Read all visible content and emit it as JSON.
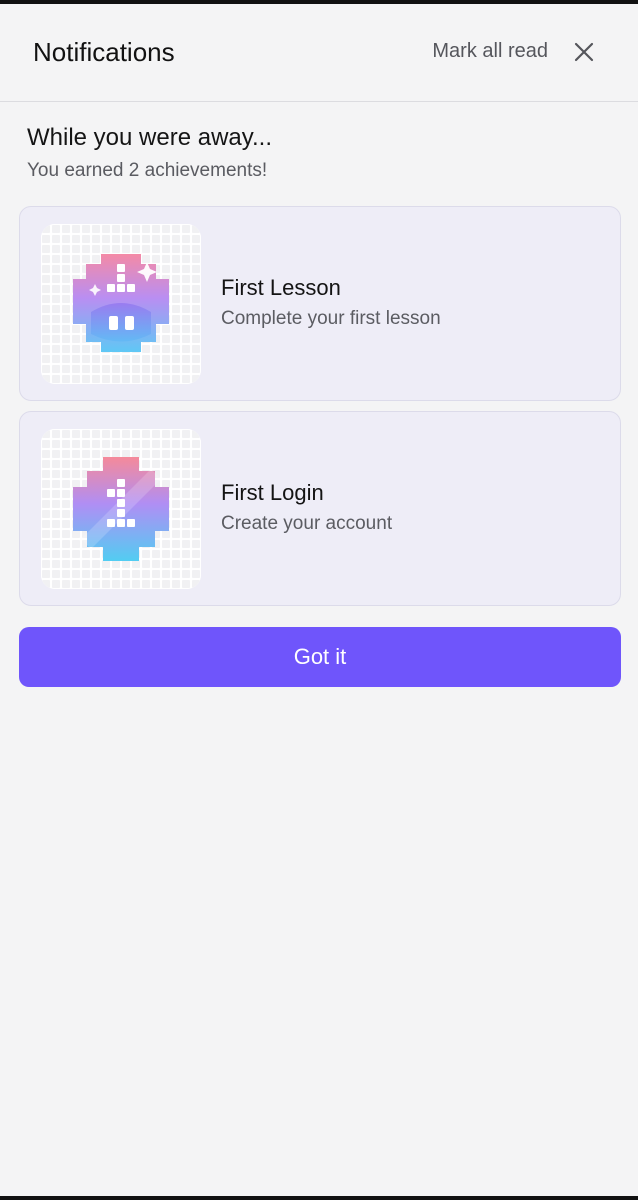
{
  "header": {
    "title": "Notifications",
    "mark_all_read": "Mark all read"
  },
  "intro": {
    "title": "While you were away...",
    "subtitle": "You earned 2 achievements!"
  },
  "achievements": [
    {
      "title": "First Lesson",
      "description": "Complete your first lesson",
      "icon": "first-lesson-badge"
    },
    {
      "title": "First Login",
      "description": "Create your account",
      "icon": "first-login-badge"
    }
  ],
  "actions": {
    "got_it": "Got it"
  },
  "colors": {
    "accent": "#6f55fb",
    "card_bg": "#eeedf7",
    "page_bg": "#f4f4f5"
  }
}
